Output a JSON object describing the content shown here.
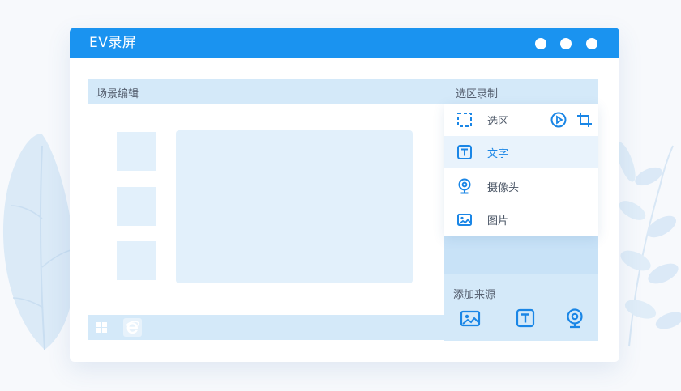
{
  "app": {
    "title": "EV录屏",
    "window_controls": [
      "dot",
      "dot",
      "dot"
    ]
  },
  "scene": {
    "title": "场景编辑",
    "thumbnail_count": 3,
    "footer_icons": [
      "windows-icon",
      "ie-browser-icon"
    ]
  },
  "sidebar": {
    "title": "选区录制",
    "menu": [
      {
        "label": "选区",
        "icon": "region-select-icon",
        "actions": [
          "play-icon",
          "crop-icon"
        ]
      },
      {
        "label": "文字",
        "icon": "text-icon",
        "active": true
      },
      {
        "label": "摄像头",
        "icon": "webcam-icon"
      },
      {
        "label": "图片",
        "icon": "image-icon"
      }
    ]
  },
  "add_source": {
    "title": "添加来源",
    "buttons": [
      "image-icon",
      "text-icon",
      "webcam-icon"
    ]
  },
  "colors": {
    "accent": "#1a93f0",
    "panel": "#d4e9f9",
    "placeholder": "#e2f0fb",
    "icon": "#1a86e6"
  }
}
